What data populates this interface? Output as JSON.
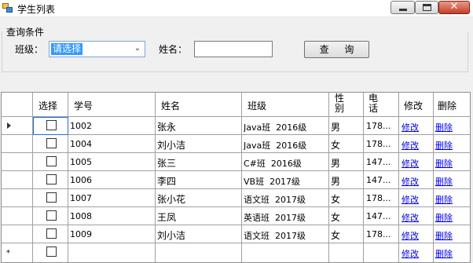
{
  "window": {
    "title": "学生列表"
  },
  "query": {
    "group_title": "查询条件",
    "class_label": "班级：",
    "class_selected": "请选择",
    "name_label": "姓名：",
    "name_value": "",
    "search_button": "查 询"
  },
  "grid": {
    "headers": [
      "选择",
      "学号",
      "姓名",
      "班级",
      "性\n别",
      "电\n话",
      "修改",
      "删除"
    ],
    "rows": [
      {
        "id": "1002",
        "name": "张永",
        "class": "Java班  2016级",
        "gender": "男",
        "phone": "178..."
      },
      {
        "id": "1004",
        "name": "刘小洁",
        "class": "Java班  2016级",
        "gender": "女",
        "phone": "178..."
      },
      {
        "id": "1005",
        "name": "张三",
        "class": "C#班  2016级",
        "gender": "男",
        "phone": "147..."
      },
      {
        "id": "1006",
        "name": "李四",
        "class": "VB班  2017级",
        "gender": "男",
        "phone": "147..."
      },
      {
        "id": "1007",
        "name": "张小花",
        "class": "语文班  2017级",
        "gender": "女",
        "phone": "178..."
      },
      {
        "id": "1008",
        "name": "王凤",
        "class": "英语班  2017级",
        "gender": "女",
        "phone": "147..."
      },
      {
        "id": "1009",
        "name": "刘小洁",
        "class": "语文班  2017级",
        "gender": "女",
        "phone": "178..."
      }
    ],
    "edit_link": "修改",
    "delete_link": "删除"
  }
}
